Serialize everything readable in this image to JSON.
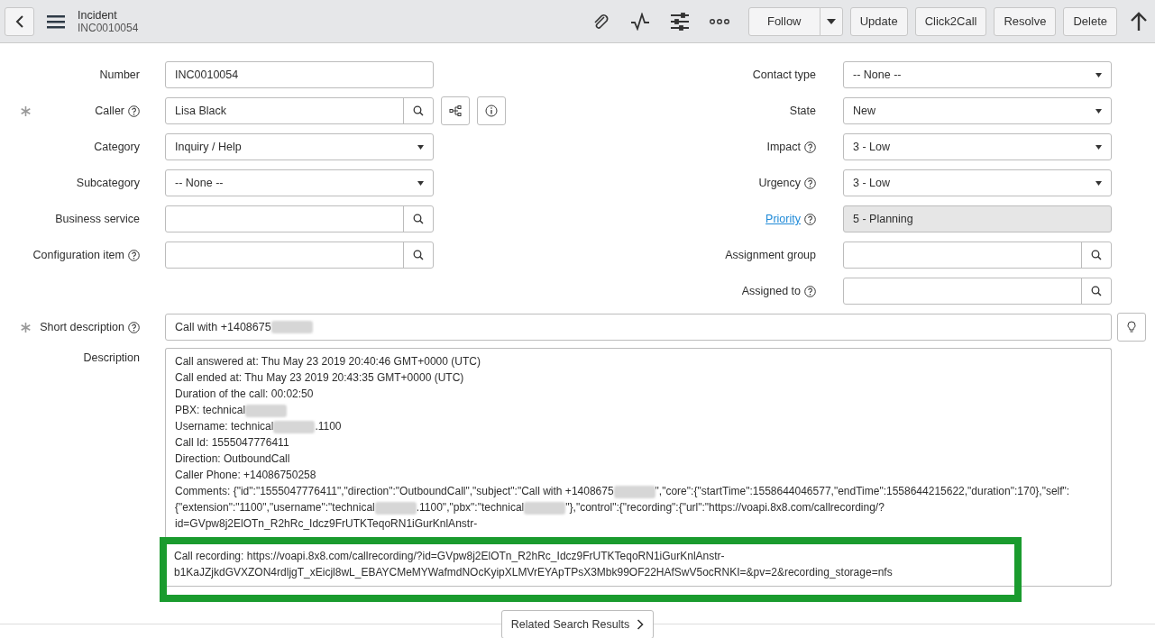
{
  "header": {
    "title": "Incident",
    "subtitle": "INC0010054",
    "buttons": [
      {
        "label": "Follow",
        "kind": "split"
      },
      {
        "label": "Update",
        "kind": "plain"
      },
      {
        "label": "Click2Call",
        "kind": "plain"
      },
      {
        "label": "Resolve",
        "kind": "plain"
      },
      {
        "label": "Delete",
        "kind": "plain"
      }
    ]
  },
  "left_fields": [
    {
      "label": "Number",
      "mandatory": false,
      "help": false,
      "kind": "text",
      "value": "INC0010054"
    },
    {
      "label": "Caller",
      "mandatory": true,
      "help": true,
      "kind": "caller",
      "value": "Lisa Black"
    },
    {
      "label": "Category",
      "mandatory": false,
      "help": false,
      "kind": "select",
      "value": "Inquiry / Help"
    },
    {
      "label": "Subcategory",
      "mandatory": false,
      "help": false,
      "kind": "select",
      "value": "-- None --"
    },
    {
      "label": "Business service",
      "mandatory": false,
      "help": false,
      "kind": "reference"
    },
    {
      "label": "Configuration item",
      "mandatory": false,
      "help": true,
      "kind": "reference"
    }
  ],
  "right_fields": [
    {
      "label": "Contact type",
      "help": false,
      "link": false,
      "kind": "select",
      "value": "-- None --"
    },
    {
      "label": "State",
      "help": false,
      "link": false,
      "kind": "select",
      "value": "New"
    },
    {
      "label": "Impact",
      "help": true,
      "link": false,
      "kind": "select",
      "value": "3 - Low"
    },
    {
      "label": "Urgency",
      "help": true,
      "link": false,
      "kind": "select",
      "value": "3 - Low"
    },
    {
      "label": "Priority",
      "help": true,
      "link": true,
      "kind": "readonly",
      "value": "5 - Planning"
    },
    {
      "label": "Assignment group",
      "help": false,
      "link": false,
      "kind": "reference"
    },
    {
      "label": "Assigned to",
      "help": true,
      "link": false,
      "kind": "reference"
    }
  ],
  "short_description": {
    "label": "Short description",
    "mandatory": true,
    "help": true,
    "value": "Call with +1408675",
    "value_redacted": true
  },
  "description": {
    "label": "Description",
    "lines": [
      [
        {
          "text": "Call answered at: Thu May 23 2019 20:40:46 GMT+0000 (UTC)",
          "redacted": false
        }
      ],
      [
        {
          "text": "Call ended at: Thu May 23 2019 20:43:35 GMT+0000 (UTC)",
          "redacted": false
        }
      ],
      [
        {
          "text": "Duration of the call: 00:02:50",
          "redacted": false
        }
      ],
      [
        {
          "text": "PBX: technical",
          "redacted": false
        },
        {
          "redacted": true
        }
      ],
      [
        {
          "text": "Username: technical",
          "redacted": false
        },
        {
          "redacted": true
        },
        {
          "text": ".1100",
          "redacted": false
        }
      ],
      [
        {
          "text": "Call Id: 1555047776411",
          "redacted": false
        }
      ],
      [
        {
          "text": "Direction: OutboundCall",
          "redacted": false
        }
      ],
      [
        {
          "text": "Caller Phone: +14086750258",
          "redacted": false
        }
      ],
      [
        {
          "text": "Comments: {\"id\":\"1555047776411\",\"direction\":\"OutboundCall\",\"subject\":\"Call with +1408675",
          "redacted": false
        },
        {
          "redacted": true
        },
        {
          "text": "\",\"core\":{\"startTime\":1558644046577,\"endTime\":1558644215622,\"duration\":170},\"self\":{\"extension\":\"1100\",\"username\":\"technical",
          "redacted": false
        },
        {
          "redacted": true
        },
        {
          "text": ".1100\",\"pbx\":\"technical",
          "redacted": false
        },
        {
          "redacted": true
        },
        {
          "text": "\"},\"control\":{\"recording\":{\"url\":\"https://voapi.8x8.com/callrecording/?id=GVpw8j2ElOTn_R2hRc_Idcz9FrUTKTeqoRN1iGurKnlAnstr-",
          "redacted": false
        }
      ]
    ],
    "highlighted_line": "Call recording: https://voapi.8x8.com/callrecording/?id=GVpw8j2ElOTn_R2hRc_Idcz9FrUTKTeqoRN1iGurKnlAnstr-b1KaJZjkdGVXZON4rdljgT_xEicjl8wL_EBAYCMeMYWafmdNOcKyipXLMVrEYApTPsX3Mbk99OF22HAfSwV5ocRNKI=&pv=2&recording_storage=nfs"
  },
  "related_tab": "Related Search Results"
}
